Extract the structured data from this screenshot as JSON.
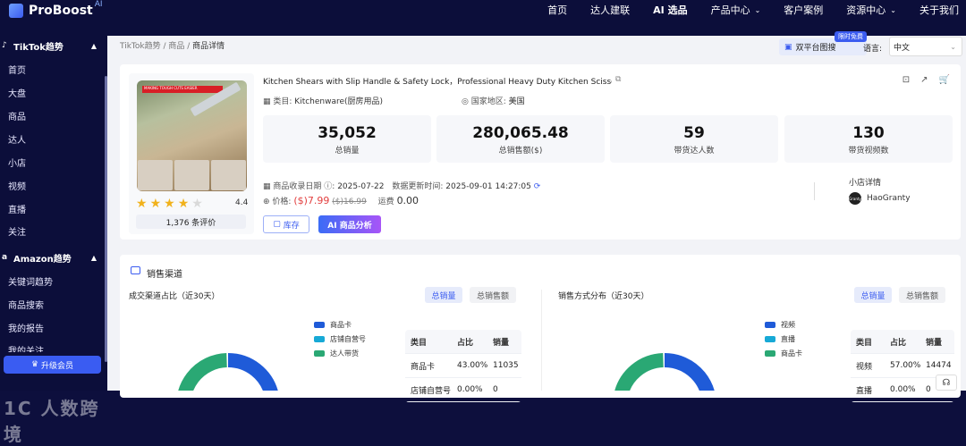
{
  "brand": {
    "name": "ProBoost",
    "suffix": "AI"
  },
  "nav": {
    "items": [
      "首页",
      "达人建联",
      "AI 选品",
      "产品中心",
      "客户案例",
      "资源中心",
      "关于我们"
    ],
    "active": "AI 选品",
    "dropdown": [
      "产品中心",
      "资源中心"
    ]
  },
  "sidebar": {
    "sections": [
      {
        "title": "TikTok趋势",
        "icon": "tiktok-icon",
        "items": [
          "首页",
          "大盘",
          "商品",
          "达人",
          "小店",
          "视频",
          "直播",
          "关注"
        ]
      },
      {
        "title": "Amazon趋势",
        "icon": "amazon-icon",
        "items": [
          "关键词趋势",
          "商品搜索",
          "我的报告",
          "我的关注"
        ]
      }
    ],
    "upgrade_label": "升级会员",
    "watermark": "1C 人数跨境"
  },
  "breadcrumb": {
    "items": [
      "TikTok趋势",
      "商品",
      "商品详情"
    ]
  },
  "header": {
    "compare_label": "双平台图搜",
    "badge": "限时免费",
    "lang_label": "语言:",
    "lang_value": "中文"
  },
  "product": {
    "title": "Kitchen Shears with Slip Handle & Safety Lock，Professional Heavy Duty Kitchen Scissors，...",
    "category_label": "类目:",
    "category": "Kitchenware(厨房用品)",
    "region_label": "国家地区:",
    "region": "美国",
    "rating": 4.4,
    "rating_text": "4.4",
    "stars_filled": 4,
    "reviews": "1,376 条评价",
    "image_banner": "MAKING TOUGH CUTS EASIER",
    "stats": [
      {
        "value": "35,052",
        "label": "总销量"
      },
      {
        "value": "280,065.48",
        "label": "总销售额($)"
      },
      {
        "value": "59",
        "label": "带货达人数"
      },
      {
        "value": "130",
        "label": "带货视频数"
      }
    ],
    "record_label": "商品收录日期",
    "record_date": "2025-07-22",
    "update_label": "数据更新时间:",
    "update_time": "2025-09-01 14:27:05",
    "price_label": "价格:",
    "price": "($)7.99",
    "price_old": "($)16.99",
    "shipping_label": "运费",
    "shipping": "0.00",
    "stock_button": "库存",
    "ai_button": "AI 商品分析",
    "shop_label": "小店详情",
    "shop_name": "HaoGranty",
    "shop_logo_text": "Granty"
  },
  "sales_channel": {
    "title": "销售渠道",
    "left": {
      "title": "成交渠道占比（近30天）",
      "toggle": [
        "总销量",
        "总销售额"
      ],
      "legend": [
        "商品卡",
        "店铺自营号",
        "达人带货"
      ],
      "table": {
        "headers": [
          "类目",
          "占比",
          "销量"
        ],
        "rows": [
          [
            "商品卡",
            "43.00%",
            "11035"
          ],
          [
            "店铺自营号",
            "0.00%",
            "0"
          ]
        ]
      }
    },
    "right": {
      "title": "销售方式分布（近30天）",
      "toggle": [
        "总销量",
        "总销售额"
      ],
      "legend": [
        "视频",
        "直播",
        "商品卡"
      ],
      "table": {
        "headers": [
          "类目",
          "占比",
          "销量"
        ],
        "rows": [
          [
            "视频",
            "57.00%",
            "14474"
          ],
          [
            "直播",
            "0.00%",
            "0"
          ]
        ]
      }
    }
  },
  "chart_data": [
    {
      "type": "pie",
      "title": "成交渠道占比（近30天）",
      "categories": [
        "商品卡",
        "店铺自营号",
        "达人带货"
      ],
      "values": [
        43,
        0,
        57
      ],
      "colors": [
        "#1f5bd8",
        "#17a9d6",
        "#2aa874"
      ]
    },
    {
      "type": "pie",
      "title": "销售方式分布（近30天）",
      "categories": [
        "视频",
        "直播",
        "商品卡"
      ],
      "values": [
        57,
        0,
        43
      ],
      "colors": [
        "#1f5bd8",
        "#17a9d6",
        "#2aa874"
      ]
    }
  ],
  "colors": {
    "accent": "#3b5cf0",
    "nav_bg": "#0c0e3a",
    "price": "#e23e3e",
    "star": "#f1b21c"
  }
}
